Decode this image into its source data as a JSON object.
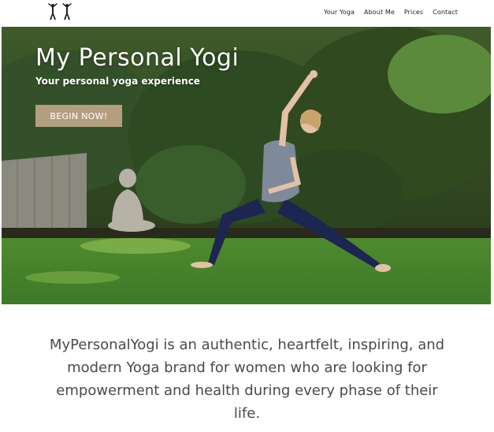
{
  "header": {
    "logo_icon": "yoga-poses-logo-icon",
    "nav": [
      {
        "label": "Your Yoga"
      },
      {
        "label": "About Me"
      },
      {
        "label": "Prices"
      },
      {
        "label": "Contact"
      }
    ]
  },
  "hero": {
    "title": "My Personal Yogi",
    "subtitle": "Your personal yoga experience",
    "cta_label": "BEGIN NOW!",
    "cta_color": "#b49e80"
  },
  "mission": {
    "text": "MyPersonalYogi is an authentic, heartfelt, inspiring, and modern Yoga brand for women who are looking for empowerment and health during every phase of their life."
  }
}
